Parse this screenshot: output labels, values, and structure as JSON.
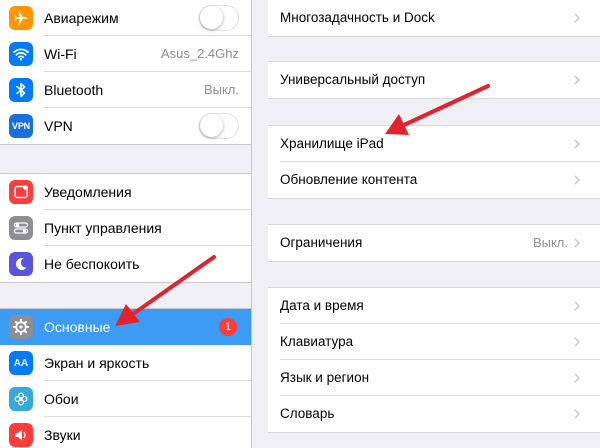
{
  "sidebar": {
    "group1": [
      {
        "label": "Авиарежим",
        "icon": "airplane-icon",
        "icon_color": "#ff9500",
        "control": "toggle",
        "toggle_on": false
      },
      {
        "label": "Wi-Fi",
        "icon": "wifi-icon",
        "icon_color": "#007aff",
        "value": "Asus_2.4Ghz"
      },
      {
        "label": "Bluetooth",
        "icon": "bluetooth-icon",
        "icon_color": "#007aff",
        "value": "Выкл."
      },
      {
        "label": "VPN",
        "icon": "vpn-icon",
        "icon_color": "#1a6fe0",
        "icon_text": "VPN",
        "control": "toggle",
        "toggle_on": false
      }
    ],
    "group2": [
      {
        "label": "Уведомления",
        "icon": "notifications-icon",
        "icon_color": "#fc3d39"
      },
      {
        "label": "Пункт управления",
        "icon": "control-center-icon",
        "icon_color": "#8e8e93"
      },
      {
        "label": "Не беспокоить",
        "icon": "moon-icon",
        "icon_color": "#5856d6"
      }
    ],
    "group3": [
      {
        "label": "Основные",
        "icon": "gear-icon",
        "icon_color": "#8e8e93",
        "selected": true,
        "badge": "1"
      },
      {
        "label": "Экран и яркость",
        "icon": "display-brightness-icon",
        "icon_color": "#007aff",
        "icon_text": "AA"
      },
      {
        "label": "Обои",
        "icon": "wallpaper-icon",
        "icon_color": "#34aadc"
      },
      {
        "label": "Звуки",
        "icon": "sounds-icon",
        "icon_color": "#fc3d39"
      }
    ]
  },
  "detail": {
    "group1": [
      {
        "label": "Многозадачность и Dock"
      }
    ],
    "group2": [
      {
        "label": "Универсальный доступ"
      }
    ],
    "group3": [
      {
        "label": "Хранилище iPad"
      },
      {
        "label": "Обновление контента"
      }
    ],
    "group4": [
      {
        "label": "Ограничения",
        "value": "Выкл."
      }
    ],
    "group5": [
      {
        "label": "Дата и время"
      },
      {
        "label": "Клавиатура"
      },
      {
        "label": "Язык и регион"
      },
      {
        "label": "Словарь"
      }
    ]
  },
  "colors": {
    "selection": "#3b9bf5",
    "badge": "#fc3d39",
    "annotation_arrow": "#e3232c",
    "background": "#efeff4"
  }
}
